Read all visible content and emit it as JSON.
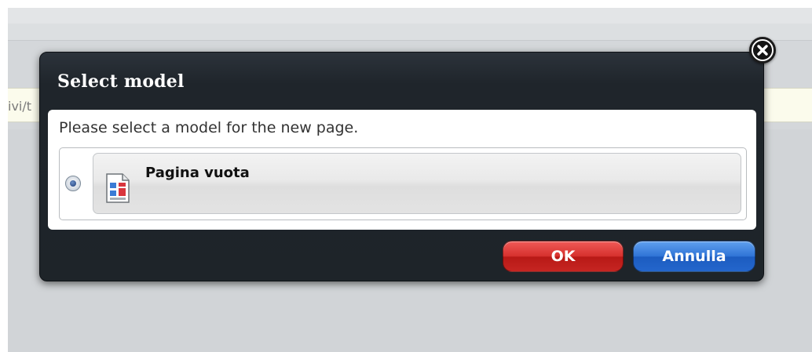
{
  "background": {
    "path_fragment": "ivi/t"
  },
  "dialog": {
    "title": "Select model",
    "instruction": "Please select a model for the new page.",
    "models": [
      {
        "name": "Pagina vuota",
        "selected": true,
        "icon": "blank-page-icon"
      }
    ],
    "ok_label": "OK",
    "cancel_label": "Annulla",
    "close_icon": "close-icon"
  },
  "colors": {
    "ok_button": "#d6302d",
    "cancel_button": "#2f73d6",
    "dialog_bg": "#1f252b"
  }
}
